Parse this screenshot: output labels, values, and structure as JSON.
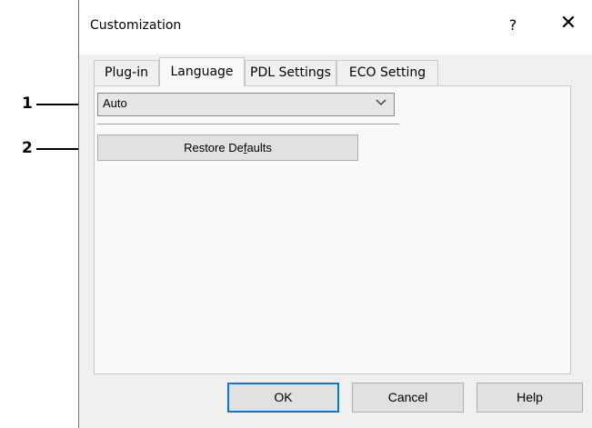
{
  "callouts": [
    {
      "label": "1"
    },
    {
      "label": "2"
    }
  ],
  "window": {
    "title": "Customization",
    "help_glyph": "?",
    "close_glyph": "✕"
  },
  "tabs": [
    {
      "label": "Plug-in",
      "active": false
    },
    {
      "label": "Language",
      "active": true
    },
    {
      "label": "PDL Settings",
      "active": false
    },
    {
      "label": "ECO Setting",
      "active": false
    }
  ],
  "language": {
    "selected_value": "Auto",
    "restore_prefix": "Restore De",
    "restore_mnemonic": "f",
    "restore_suffix": "aults"
  },
  "buttons": {
    "ok": "OK",
    "cancel": "Cancel",
    "help": "Help"
  },
  "colors": {
    "default_button_border": "#0078d7",
    "dialog_background": "#f0f0f0"
  }
}
